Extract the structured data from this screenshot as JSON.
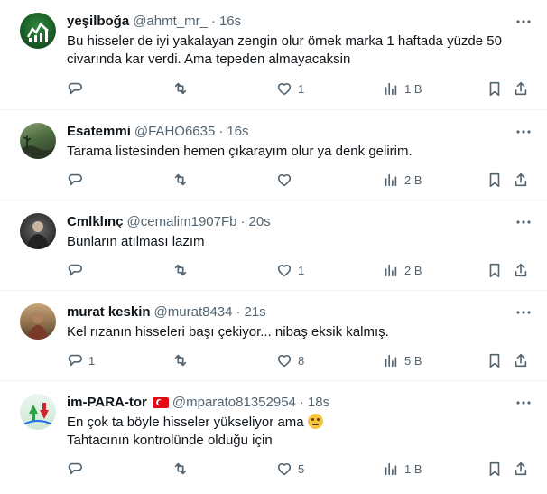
{
  "tweets": [
    {
      "name": "yeşilboğa",
      "handle": "@ahmt_mr_",
      "dot": "·",
      "time": "16s",
      "lines": [
        "Bu hisseler de iyi yakalayan zengin olur örnek  marka 1 haftada yüzde 50",
        "civarında kar verdi. Ama tepeden almayacaksin"
      ],
      "replies": "",
      "retweets": "",
      "likes": "1",
      "views": "1 B",
      "avatar_colors": [
        "#1f6b2e",
        "#0c3b18"
      ]
    },
    {
      "name": "Esatemmi",
      "handle": "@FAHO6635",
      "dot": "·",
      "time": "16s",
      "lines": [
        "Tarama listesinden hemen çıkarayım olur ya denk gelirim."
      ],
      "replies": "",
      "retweets": "",
      "likes": "",
      "views": "2 B",
      "avatar_colors": [
        "#5b7a4a",
        "#2f4030"
      ]
    },
    {
      "name": "Cmlklınç",
      "handle": "@cemalim1907Fb",
      "dot": "·",
      "time": "20s",
      "lines": [
        "Bunların atılması lazım"
      ],
      "replies": "",
      "retweets": "",
      "likes": "1",
      "views": "2 B",
      "avatar_colors": [
        "#3a3a3a",
        "#111111"
      ]
    },
    {
      "name": "murat keskin",
      "handle": "@murat8434",
      "dot": "·",
      "time": "21s",
      "lines": [
        "Kel rızanın hisseleri başı çekiyor... nibaş eksik kalmış."
      ],
      "replies": "1",
      "retweets": "",
      "likes": "8",
      "views": "5 B",
      "avatar_colors": [
        "#a07a4f",
        "#5a4a3a"
      ]
    },
    {
      "name": "im-PARA-tor",
      "handle": "@mparato81352954",
      "dot": "·",
      "time": "18s",
      "lines": [
        "En çok ta böyle hisseler yükseliyor ama",
        "Tahtacının kontrolünde olduğu için"
      ],
      "replies": "",
      "retweets": "",
      "likes": "5",
      "views": "1 B",
      "avatar_colors": [
        "#3aa64a",
        "#c0392b"
      ]
    }
  ],
  "icons": {
    "reply": "reply-icon",
    "retweet": "retweet-icon",
    "like": "heart-icon",
    "views": "views-icon",
    "bookmark": "bookmark-icon",
    "share": "share-icon",
    "more": "more-icon"
  }
}
